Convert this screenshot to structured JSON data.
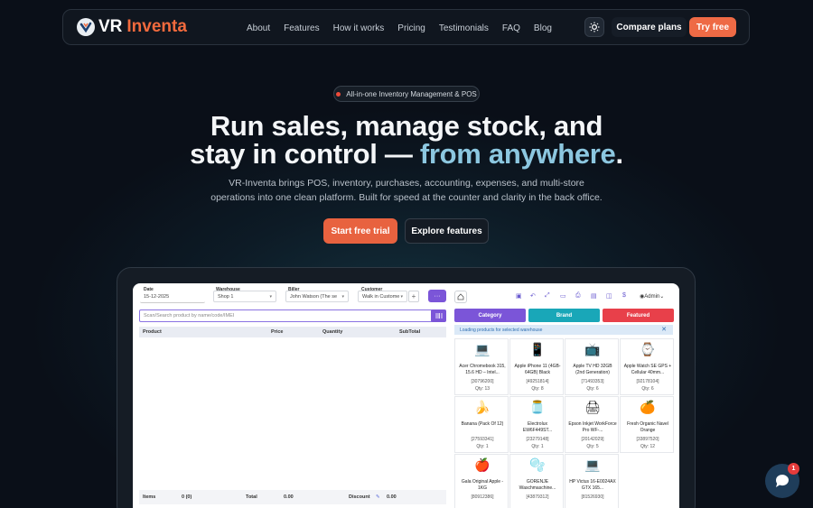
{
  "brand": {
    "prefix": "VR",
    "name": "Inventa",
    "accent_color": "#f26a3d"
  },
  "nav": {
    "links": [
      "About",
      "Features",
      "How it works",
      "Pricing",
      "Testimonials",
      "FAQ",
      "Blog"
    ],
    "theme_icon": "sun-icon",
    "compare_label": "Compare plans",
    "try_label": "Try free"
  },
  "hero": {
    "badge": "All-in-one Inventory Management & POS",
    "headline_line1": "Run sales, manage stock, and",
    "headline_line2_a": "stay in control — ",
    "headline_line2_b": "from anywhere",
    "headline_line2_c": ".",
    "sub_line1": "VR-Inventa brings POS, inventory, purchases, accounting, expenses, and multi-store",
    "sub_line2": "operations into one clean platform. Built for speed at the counter and clarity in the back office.",
    "cta_primary": "Start free trial",
    "cta_secondary": "Explore features"
  },
  "pos": {
    "date_label": "Date",
    "date_value": "15-12-2025",
    "warehouse_label": "Warehouse",
    "warehouse_value": "Shop 1",
    "biller_label": "Biller",
    "biller_value": "John Watson (The se",
    "customer_label": "Customer",
    "customer_value": "Walk in Custome",
    "add_label": "+",
    "more_label": "···",
    "search_placeholder": "Scan/Search product by name/code/IMEI",
    "columns": {
      "product": "Product",
      "price": "Price",
      "quantity": "Quantity",
      "subtotal": "SubTotal"
    },
    "footer": {
      "items_label": "Items",
      "items_value": "0 (0)",
      "total_label": "Total",
      "total_value": "0.00",
      "discount_label": "Discount",
      "discount_value": "0.00"
    },
    "admin_label": "Admin",
    "tabs": [
      {
        "label": "Category",
        "color": "#7b55d8"
      },
      {
        "label": "Brand",
        "color": "#19a7b8"
      },
      {
        "label": "Featured",
        "color": "#e8404a"
      }
    ],
    "loading_text": "Loading products for selected warehouse",
    "products": [
      {
        "icon": "💻",
        "name": "Acer Chromebook 315, 15.6 HD – Intel...",
        "code": "[30796200]",
        "qty": "Qty: 13"
      },
      {
        "icon": "📱",
        "name": "Apple iPhone 11 (4GB-64GB) Black",
        "code": "[49251814]",
        "qty": "Qty: 8"
      },
      {
        "icon": "📺",
        "name": "Apple TV HD 32GB (2nd Generation)",
        "code": "[71493353]",
        "qty": "Qty: 6"
      },
      {
        "icon": "⌚",
        "name": "Apple Watch SE GPS + Cellular 40mm...",
        "code": "[92178104]",
        "qty": "Qty: 6"
      },
      {
        "icon": "🍌",
        "name": "Banana (Pack Of 12)",
        "code": "[27593341]",
        "qty": "Qty: 1"
      },
      {
        "icon": "🫙",
        "name": "Electrolux EW6F449ST...",
        "code": "[23279148]",
        "qty": "Qty: 1"
      },
      {
        "icon": "🖨",
        "name": "Epson Inkjet WorkForce Pro WF-...",
        "code": "[20142029]",
        "qty": "Qty: 5"
      },
      {
        "icon": "🍊",
        "name": "Fresh Organic Navel Orange",
        "code": "[33897520]",
        "qty": "Qty: 12"
      },
      {
        "icon": "🍎",
        "name": "Gala Original Apple - 1KG",
        "code": "[80912386]",
        "qty": ""
      },
      {
        "icon": "🫧",
        "name": "GORENJE Waschmaschine...",
        "code": "[43879312]",
        "qty": ""
      },
      {
        "icon": "💻",
        "name": "HP Victus 16-E0024AX GTX 165...",
        "code": "[81526930]",
        "qty": ""
      }
    ]
  },
  "chat": {
    "badge": "1"
  }
}
